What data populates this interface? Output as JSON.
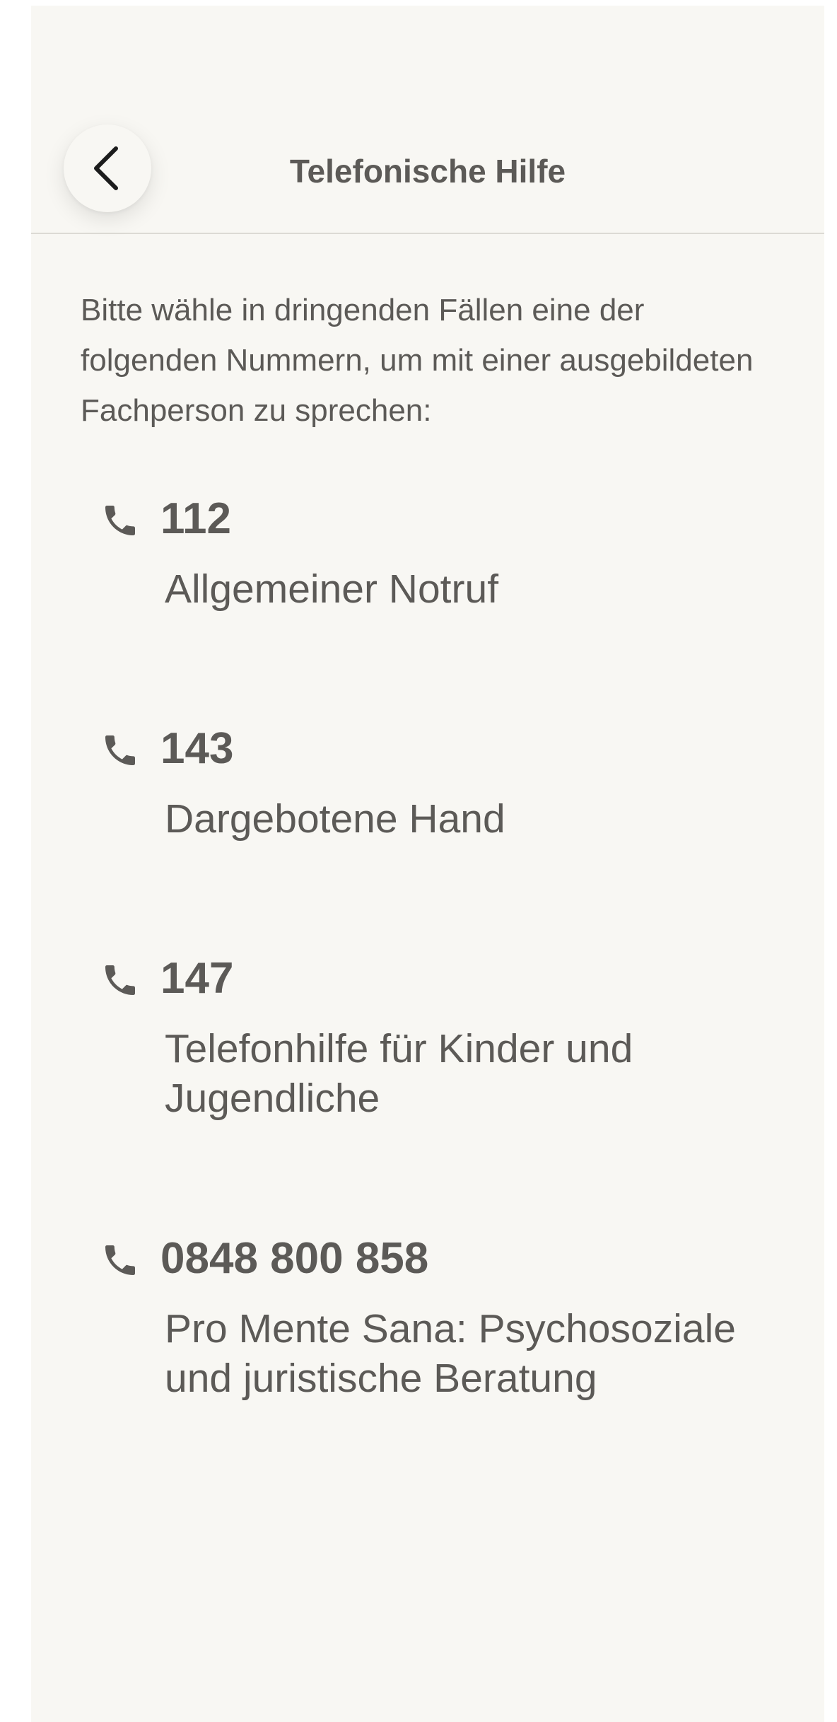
{
  "header": {
    "title": "Telefonische Hilfe",
    "back_icon": "chevron-left-icon"
  },
  "intro": "Bitte wähle in dringenden Fällen eine der folgenden Nummern, um mit einer ausgebildeten Fachperson zu sprechen:",
  "contacts": [
    {
      "number": "112",
      "label": "Allgemeiner Notruf",
      "icon": "phone-icon"
    },
    {
      "number": "143",
      "label": "Dargebotene Hand",
      "icon": "phone-icon"
    },
    {
      "number": "147",
      "label": "Telefonhilfe für Kinder und Jugendliche",
      "icon": "phone-icon"
    },
    {
      "number": "0848 800 858",
      "label": "Pro Mente Sana: Psychosoziale und juristische Beratung",
      "icon": "phone-icon"
    }
  ],
  "colors": {
    "background": "#f8f7f3",
    "text": "#5c5a57",
    "divider": "#dcdad4"
  }
}
